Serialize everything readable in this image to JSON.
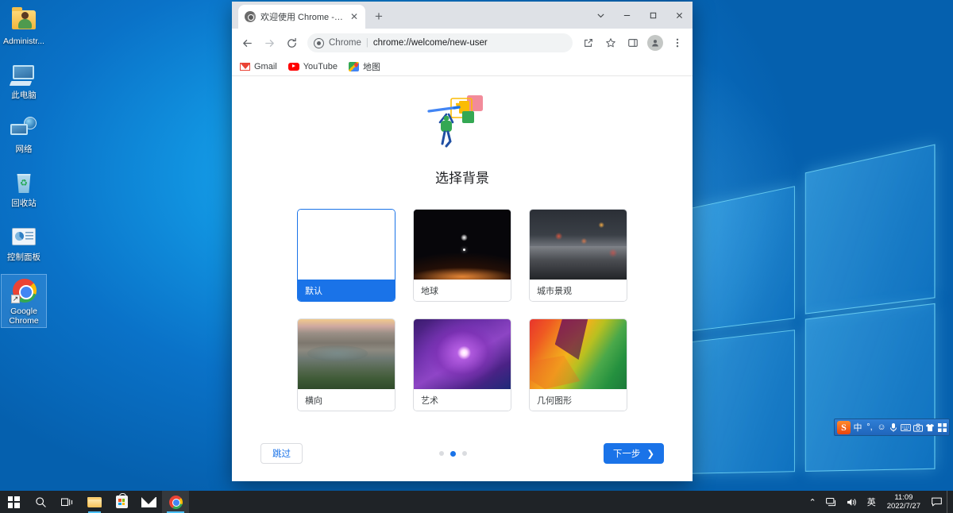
{
  "desktop": {
    "icons": [
      {
        "label": "Administr...",
        "icon": "user-folder-icon"
      },
      {
        "label": "此电脑",
        "icon": "this-pc-icon"
      },
      {
        "label": "网络",
        "icon": "network-icon"
      },
      {
        "label": "回收站",
        "icon": "recycle-bin-icon"
      },
      {
        "label": "控制面板",
        "icon": "control-panel-icon"
      },
      {
        "label": "Google\nChrome",
        "icon": "chrome-icon"
      }
    ],
    "chrome_label_line1": "Google",
    "chrome_label_line2": "Chrome"
  },
  "browser": {
    "tab": {
      "title": "欢迎使用 Chrome - 选择背景",
      "favicon": "chrome-favicon",
      "close_label": "✕"
    },
    "new_tab_label": "+",
    "window_controls": {
      "tab_search": "tab-search-chevron",
      "minimize": "minimize",
      "maximize": "maximize",
      "close": "close"
    },
    "toolbar": {
      "back": "back-arrow",
      "forward": "forward-arrow",
      "reload": "reload-arrow",
      "share": "share-icon",
      "bookmark": "star-icon",
      "side_panel": "side-panel-icon",
      "profile": "profile-avatar",
      "menu": "three-dot-menu"
    },
    "omnibox": {
      "scheme_label": "Chrome",
      "separator": "|",
      "url": "chrome://welcome/new-user"
    },
    "bookmarks": [
      {
        "label": "Gmail",
        "icon": "gmail-icon"
      },
      {
        "label": "YouTube",
        "icon": "youtube-icon"
      },
      {
        "label": "地图",
        "icon": "google-maps-icon"
      }
    ]
  },
  "page": {
    "hero_illustration": "person-painting-illustration",
    "title": "选择背景",
    "backgrounds": [
      {
        "label": "默认",
        "thumb": "th-default",
        "selected": true
      },
      {
        "label": "地球",
        "thumb": "th-earth",
        "selected": false
      },
      {
        "label": "城市景观",
        "thumb": "th-city",
        "selected": false
      },
      {
        "label": "横向",
        "thumb": "th-landscape",
        "selected": false
      },
      {
        "label": "艺术",
        "thumb": "th-art",
        "selected": false
      },
      {
        "label": "几何图形",
        "thumb": "th-geo",
        "selected": false
      }
    ],
    "footer": {
      "skip_label": "跳过",
      "next_label": "下一步",
      "next_chevron": "❯",
      "dots_total": 3,
      "dots_active_index": 1
    }
  },
  "ime": {
    "logo": "S",
    "mode": "中",
    "punctuation": "°,",
    "emoji": "☺",
    "mic": "🎤",
    "keyboard": "⌨",
    "screenshot": "✂",
    "skin": "👕",
    "apps": "▦"
  },
  "taskbar": {
    "items": [
      {
        "name": "start-button",
        "icon": "windows-logo"
      },
      {
        "name": "search-button",
        "icon": "search-icon"
      },
      {
        "name": "task-view-button",
        "icon": "task-view-icon"
      },
      {
        "name": "file-explorer-button",
        "icon": "file-explorer-icon"
      },
      {
        "name": "microsoft-store-button",
        "icon": "store-icon"
      },
      {
        "name": "mail-button",
        "icon": "mail-icon"
      },
      {
        "name": "chrome-taskbar-button",
        "icon": "chrome-icon"
      }
    ],
    "tray": {
      "show_hidden": "⌃",
      "network": "network-icon",
      "volume": "volume-icon",
      "ime_lang": "英",
      "time": "11:09",
      "date": "2022/7/27",
      "notifications": "notification-icon"
    }
  },
  "colors": {
    "accent_blue": "#1a73e8",
    "desktop_blue": "#0a72c8",
    "taskbar": "#1f2327",
    "chrome_tabstrip": "#dee1e6"
  }
}
